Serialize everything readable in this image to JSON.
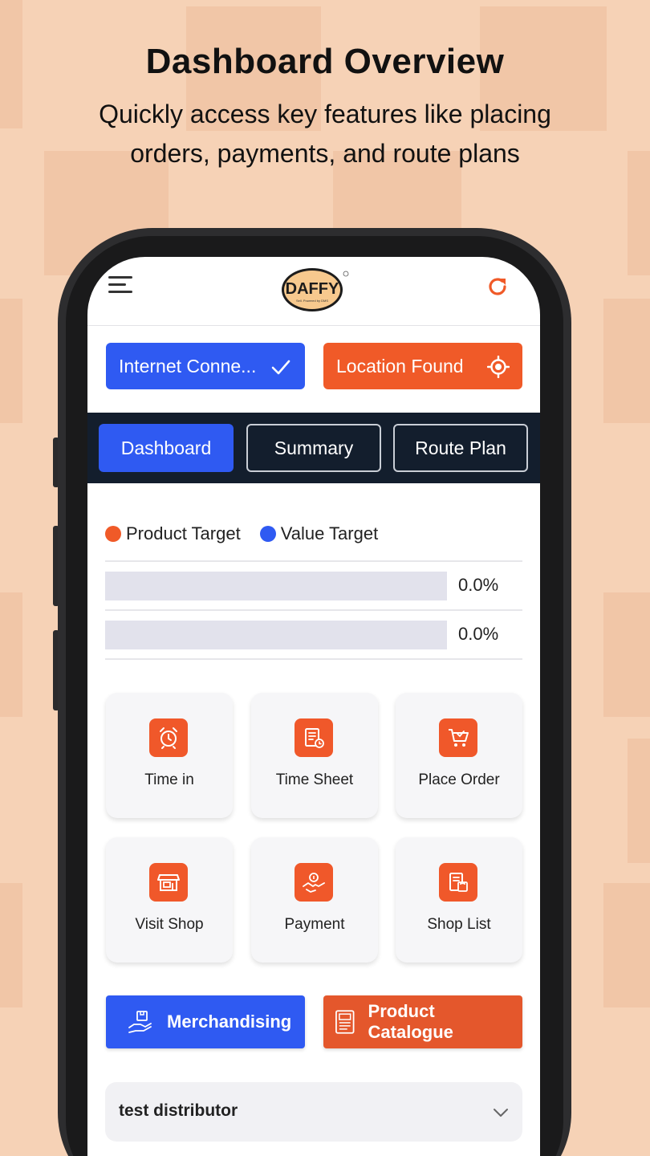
{
  "hero": {
    "title": "Dashboard Overview",
    "subtitle": "Quickly access key features like placing orders, payments, and route plans"
  },
  "app": {
    "logo_text": "DAFFY",
    "logo_tagline": "Sell. Powered by DMS"
  },
  "status": {
    "internet_label": "Internet Conne...",
    "location_label": "Location Found"
  },
  "tabs": [
    {
      "label": "Dashboard",
      "active": true
    },
    {
      "label": "Summary",
      "active": false
    },
    {
      "label": "Route Plan",
      "active": false
    }
  ],
  "targets": {
    "legend": [
      {
        "label": "Product Target",
        "color": "#f05a28"
      },
      {
        "label": "Value Target",
        "color": "#2f5af2"
      }
    ],
    "bars": [
      {
        "value": 0.0,
        "label": "0.0%"
      },
      {
        "value": 0.0,
        "label": "0.0%"
      }
    ]
  },
  "tiles": [
    {
      "label": "Time in",
      "icon": "alarm-clock-icon"
    },
    {
      "label": "Time Sheet",
      "icon": "timesheet-icon"
    },
    {
      "label": "Place Order",
      "icon": "cart-icon"
    },
    {
      "label": "Visit Shop",
      "icon": "shop-icon"
    },
    {
      "label": "Payment",
      "icon": "handshake-payment-icon"
    },
    {
      "label": "Shop List",
      "icon": "shop-list-icon"
    }
  ],
  "actions": {
    "merchandising_label": "Merchandising",
    "catalogue_label": "Product Catalogue"
  },
  "distributor": {
    "selected": "test distributor"
  },
  "colors": {
    "accent_orange": "#f05a28",
    "accent_blue": "#2f5af2",
    "tabbar_bg": "#131e2d",
    "background": "#f6d2b6"
  }
}
